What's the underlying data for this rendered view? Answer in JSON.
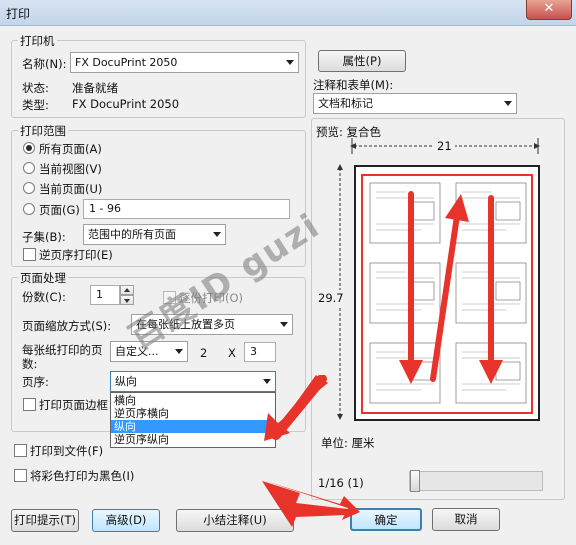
{
  "window": {
    "title": "打印",
    "close_glyph": "✕"
  },
  "printer": {
    "group_label": "打印机",
    "name_label": "名称(N):",
    "name_value": "FX DocuPrint 2050",
    "status_label": "状态:",
    "status_value": "准备就绪",
    "type_label": "类型:",
    "type_value": "FX DocuPrint 2050",
    "properties_button": "属性(P)",
    "annotations_label": "注释和表单(M):",
    "annotations_value": "文档和标记"
  },
  "range": {
    "group_label": "打印范围",
    "options": [
      {
        "label": "所有页面(A)",
        "selected": true
      },
      {
        "label": "当前视图(V)",
        "selected": false
      },
      {
        "label": "当前页面(U)",
        "selected": false
      },
      {
        "label": "页面(G)",
        "selected": false
      }
    ],
    "pages_value": "1 - 96",
    "subset_label": "子集(B):",
    "subset_value": "范围中的所有页面",
    "reverse_label": "逆页序打印(E)"
  },
  "handling": {
    "group_label": "页面处理",
    "copies_label": "份数(C):",
    "copies_value": "1",
    "collate_label": "逐份打印(O)",
    "scaling_label": "页面缩放方式(S):",
    "scaling_value": "在每张纸上放置多页",
    "pages_per_sheet_label": "每张纸打印的页数:",
    "pages_per_sheet_value": "自定义...",
    "grid_cols": "2",
    "grid_x": "X",
    "grid_rows": "3",
    "page_order_label": "页序:",
    "page_order_value": "纵向",
    "page_order_options": [
      "横向",
      "逆页序横向",
      "纵向",
      "逆页序纵向"
    ],
    "page_order_highlighted": 2,
    "border_label": "打印页面边框"
  },
  "bottom": {
    "print_to_file_label": "打印到文件(F)",
    "color_black_label": "将彩色打印为黑色(I)",
    "tips_button": "打印提示(T)",
    "advanced_button": "高级(D)",
    "summary_button": "小结注释(U)",
    "ok_button": "确定",
    "cancel_button": "取消"
  },
  "preview": {
    "label": "预览: 复合色",
    "width_value": "21",
    "height_value": "29.7",
    "unit_label": "单位: 厘米",
    "page_counter": "1/16 (1)"
  },
  "watermark": {
    "text": "百度ID guzi"
  },
  "colors": {
    "annotation_red": "#e8332a",
    "selection_blue": "#3399ff",
    "button_blue": "#3c7fb1"
  }
}
